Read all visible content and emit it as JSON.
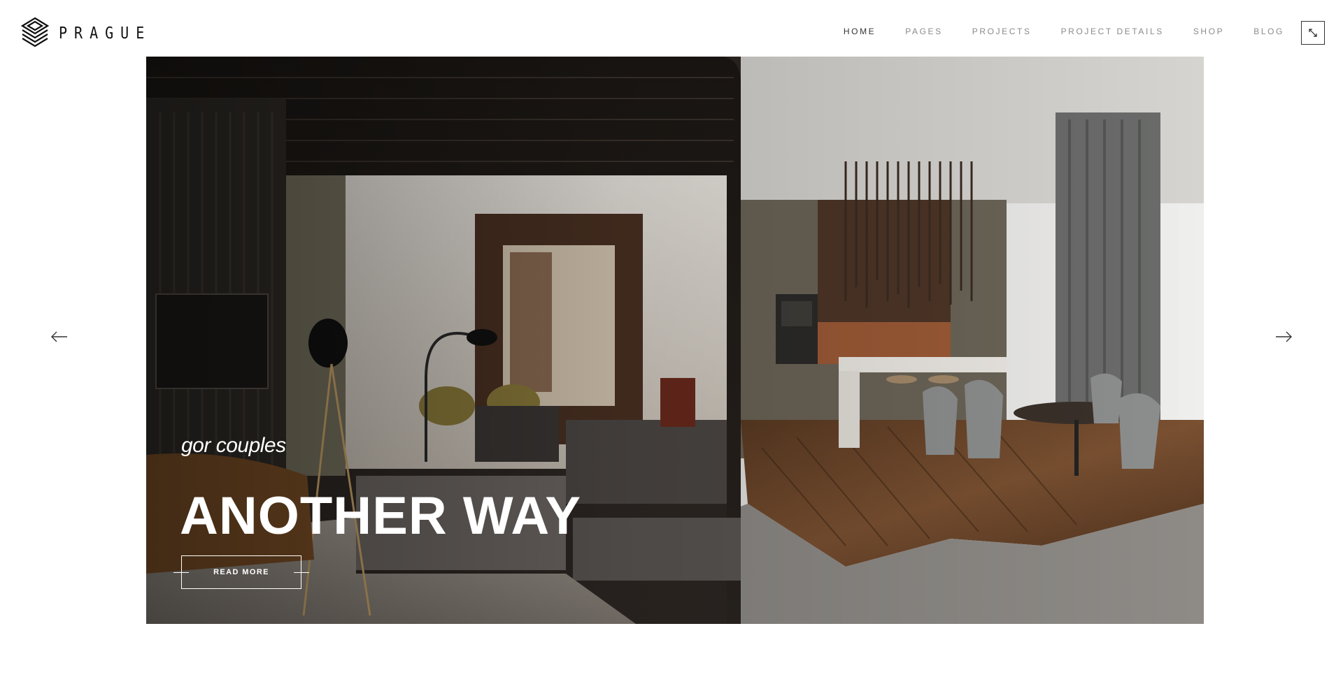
{
  "brand": {
    "name": "PRAGUE",
    "logo_icon": "layered-diamond-icon"
  },
  "nav": {
    "items": [
      {
        "label": "HOME",
        "active": true
      },
      {
        "label": "PAGES",
        "active": false
      },
      {
        "label": "PROJECTS",
        "active": false
      },
      {
        "label": "PROJECT DETAILS",
        "active": false
      },
      {
        "label": "SHOP",
        "active": false
      },
      {
        "label": "BLOG",
        "active": false
      }
    ],
    "toggle_icon": "expand-arrows-icon"
  },
  "slider": {
    "prev_icon": "arrow-left-icon",
    "next_icon": "arrow-right-icon",
    "slide": {
      "subtitle": "gor couples",
      "title": "ANOTHER WAY",
      "button_label": "READ MORE",
      "image_description_icon": "interior-photo"
    }
  },
  "colors": {
    "accent": "#ffffff",
    "text": "#222222",
    "nav_muted": "#8a8a8a"
  }
}
